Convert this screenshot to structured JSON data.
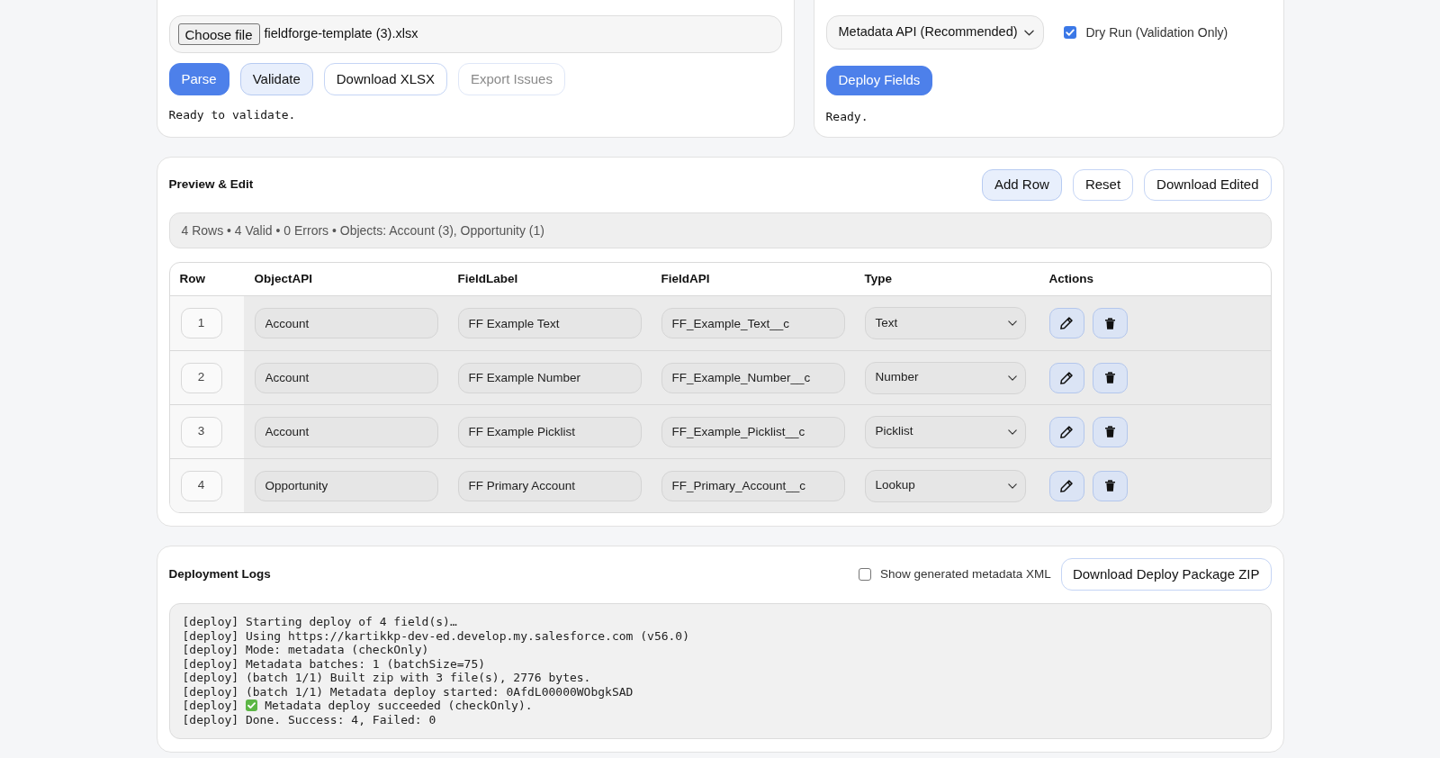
{
  "upload_template": {
    "choose_file_button": "Choose file",
    "file_name": "fieldforge-template (3).xlsx",
    "buttons": [
      {
        "label": "Parse",
        "kind": "primary",
        "disabled": false
      },
      {
        "label": "Validate",
        "kind": "soft",
        "disabled": false
      },
      {
        "label": "Download XLSX",
        "kind": "outline",
        "disabled": false
      },
      {
        "label": "Export Issues",
        "kind": "outline",
        "disabled": true
      }
    ],
    "status": "Ready to validate."
  },
  "deployment": {
    "method_select": "Metadata API (Recommended)",
    "dry_run": {
      "label": "Dry Run (Validation Only)",
      "checked": true
    },
    "deploy_button": "Deploy Fields",
    "status": "Ready."
  },
  "preview_edit": {
    "title": "Preview & Edit",
    "buttons": [
      {
        "label": "Add Row",
        "kind": "soft"
      },
      {
        "label": "Reset",
        "kind": "outline"
      },
      {
        "label": "Download Edited",
        "kind": "outline"
      }
    ],
    "summary": "4 Rows • 4 Valid • 0 Errors • Objects: Account (3), Opportunity (1)",
    "table": {
      "columns": [
        "Row",
        "ObjectAPI",
        "FieldLabel",
        "FieldAPI",
        "Type",
        "Actions"
      ],
      "rows": [
        {
          "row": "1",
          "object_api": "Account",
          "field_label": "FF Example Text",
          "field_api": "FF_Example_Text__c",
          "type": "Text"
        },
        {
          "row": "2",
          "object_api": "Account",
          "field_label": "FF Example Number",
          "field_api": "FF_Example_Number__c",
          "type": "Number"
        },
        {
          "row": "3",
          "object_api": "Account",
          "field_label": "FF Example Picklist",
          "field_api": "FF_Example_Picklist__c",
          "type": "Picklist"
        },
        {
          "row": "4",
          "object_api": "Opportunity",
          "field_label": "FF Primary Account",
          "field_api": "FF_Primary_Account__c",
          "type": "Lookup"
        }
      ]
    }
  },
  "deployment_logs": {
    "title": "Deployment Logs",
    "show_xml": {
      "label": "Show generated metadata XML",
      "checked": false
    },
    "download_button": "Download Deploy Package ZIP",
    "lines": [
      {
        "kind": "plain",
        "text": "[deploy] Starting deploy of 4 field(s)…"
      },
      {
        "kind": "plain",
        "text": "[deploy] Using https://kartikkp-dev-ed.develop.my.salesforce.com (v56.0)"
      },
      {
        "kind": "plain",
        "text": "[deploy] Mode: metadata (checkOnly)"
      },
      {
        "kind": "plain",
        "text": "[deploy] Metadata batches: 1 (batchSize=75)"
      },
      {
        "kind": "plain",
        "text": "[deploy] (batch 1/1) Built zip with 3 file(s), 2776 bytes."
      },
      {
        "kind": "plain",
        "text": "[deploy] (batch 1/1) Metadata deploy started: 0AfdL00000WObgkSAD"
      },
      {
        "kind": "success",
        "tag": "[deploy]",
        "text": "Metadata deploy succeeded (checkOnly)."
      },
      {
        "kind": "plain",
        "text": "[deploy] Done. Success: 4, Failed: 0"
      }
    ]
  }
}
